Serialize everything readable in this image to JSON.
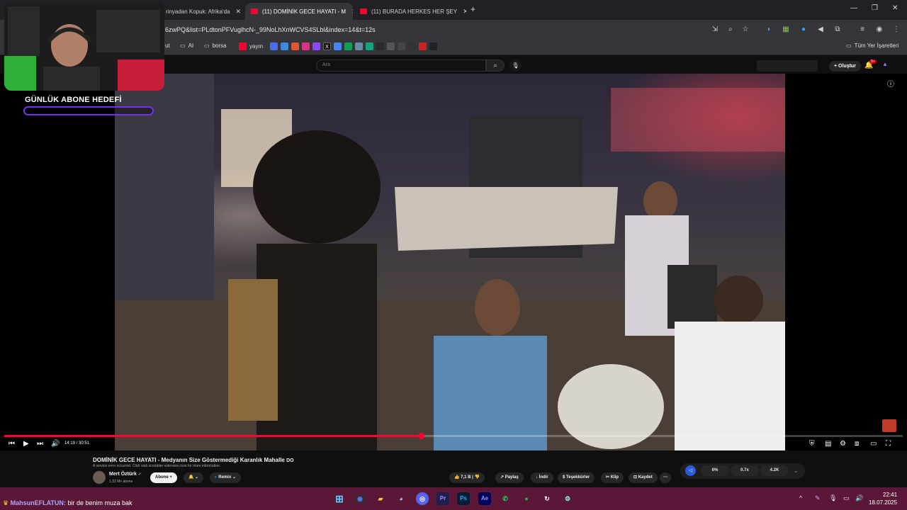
{
  "tabs": [
    {
      "label": "rinyadan Kopuk: Afrika'da",
      "active": false
    },
    {
      "label": "(11) DOMİNİK GECE HAYATI - M",
      "active": true
    },
    {
      "label": "(11) BURADA HERKES HER ŞEY",
      "active": false
    }
  ],
  "url": "6zwPQ&list=PLdtonPFVuglhcN-_99NoLhXnWCVS4SLbl&index=14&t=12s",
  "bookmarks": [
    {
      "label": "ut"
    },
    {
      "label": "AI"
    },
    {
      "label": "borsa"
    },
    {
      "label": "yayın"
    }
  ],
  "all_bookmarks": "Tüm Yer İşaretleri",
  "search_placeholder": "Ara",
  "create_label": "Oluştur",
  "notif_count": "9+",
  "overlay": {
    "goal_label": "GÜNLÜK ABONE HEDEFİ"
  },
  "player": {
    "time": "14:19 / 30:51",
    "progress": 0.464
  },
  "video": {
    "title": "DOMİNİK GECE HAYATI - Medyanın Size Göstermediği Karanlık Mahalle",
    "title_suffix": "DO",
    "error": "A service error occurred. Click web scrobbler extension icon for more information.",
    "channel": "Mert Öztürk",
    "subscribers": "1,32 Mn abone",
    "subscribe": "Abone",
    "remix": "Remix",
    "likes": "7,1 B",
    "share": "Paylaş",
    "download": "İndir",
    "thanks": "Teşekkürler",
    "clip": "Klip",
    "save": "Kaydet"
  },
  "stats": [
    "6%",
    "0.7x",
    "4.2K"
  ],
  "taskbar": {
    "chat_user": "MahsunEFLATUN:",
    "chat_msg": "bir de benim muza bak",
    "time": "22:41",
    "date": "18.07.2025"
  }
}
